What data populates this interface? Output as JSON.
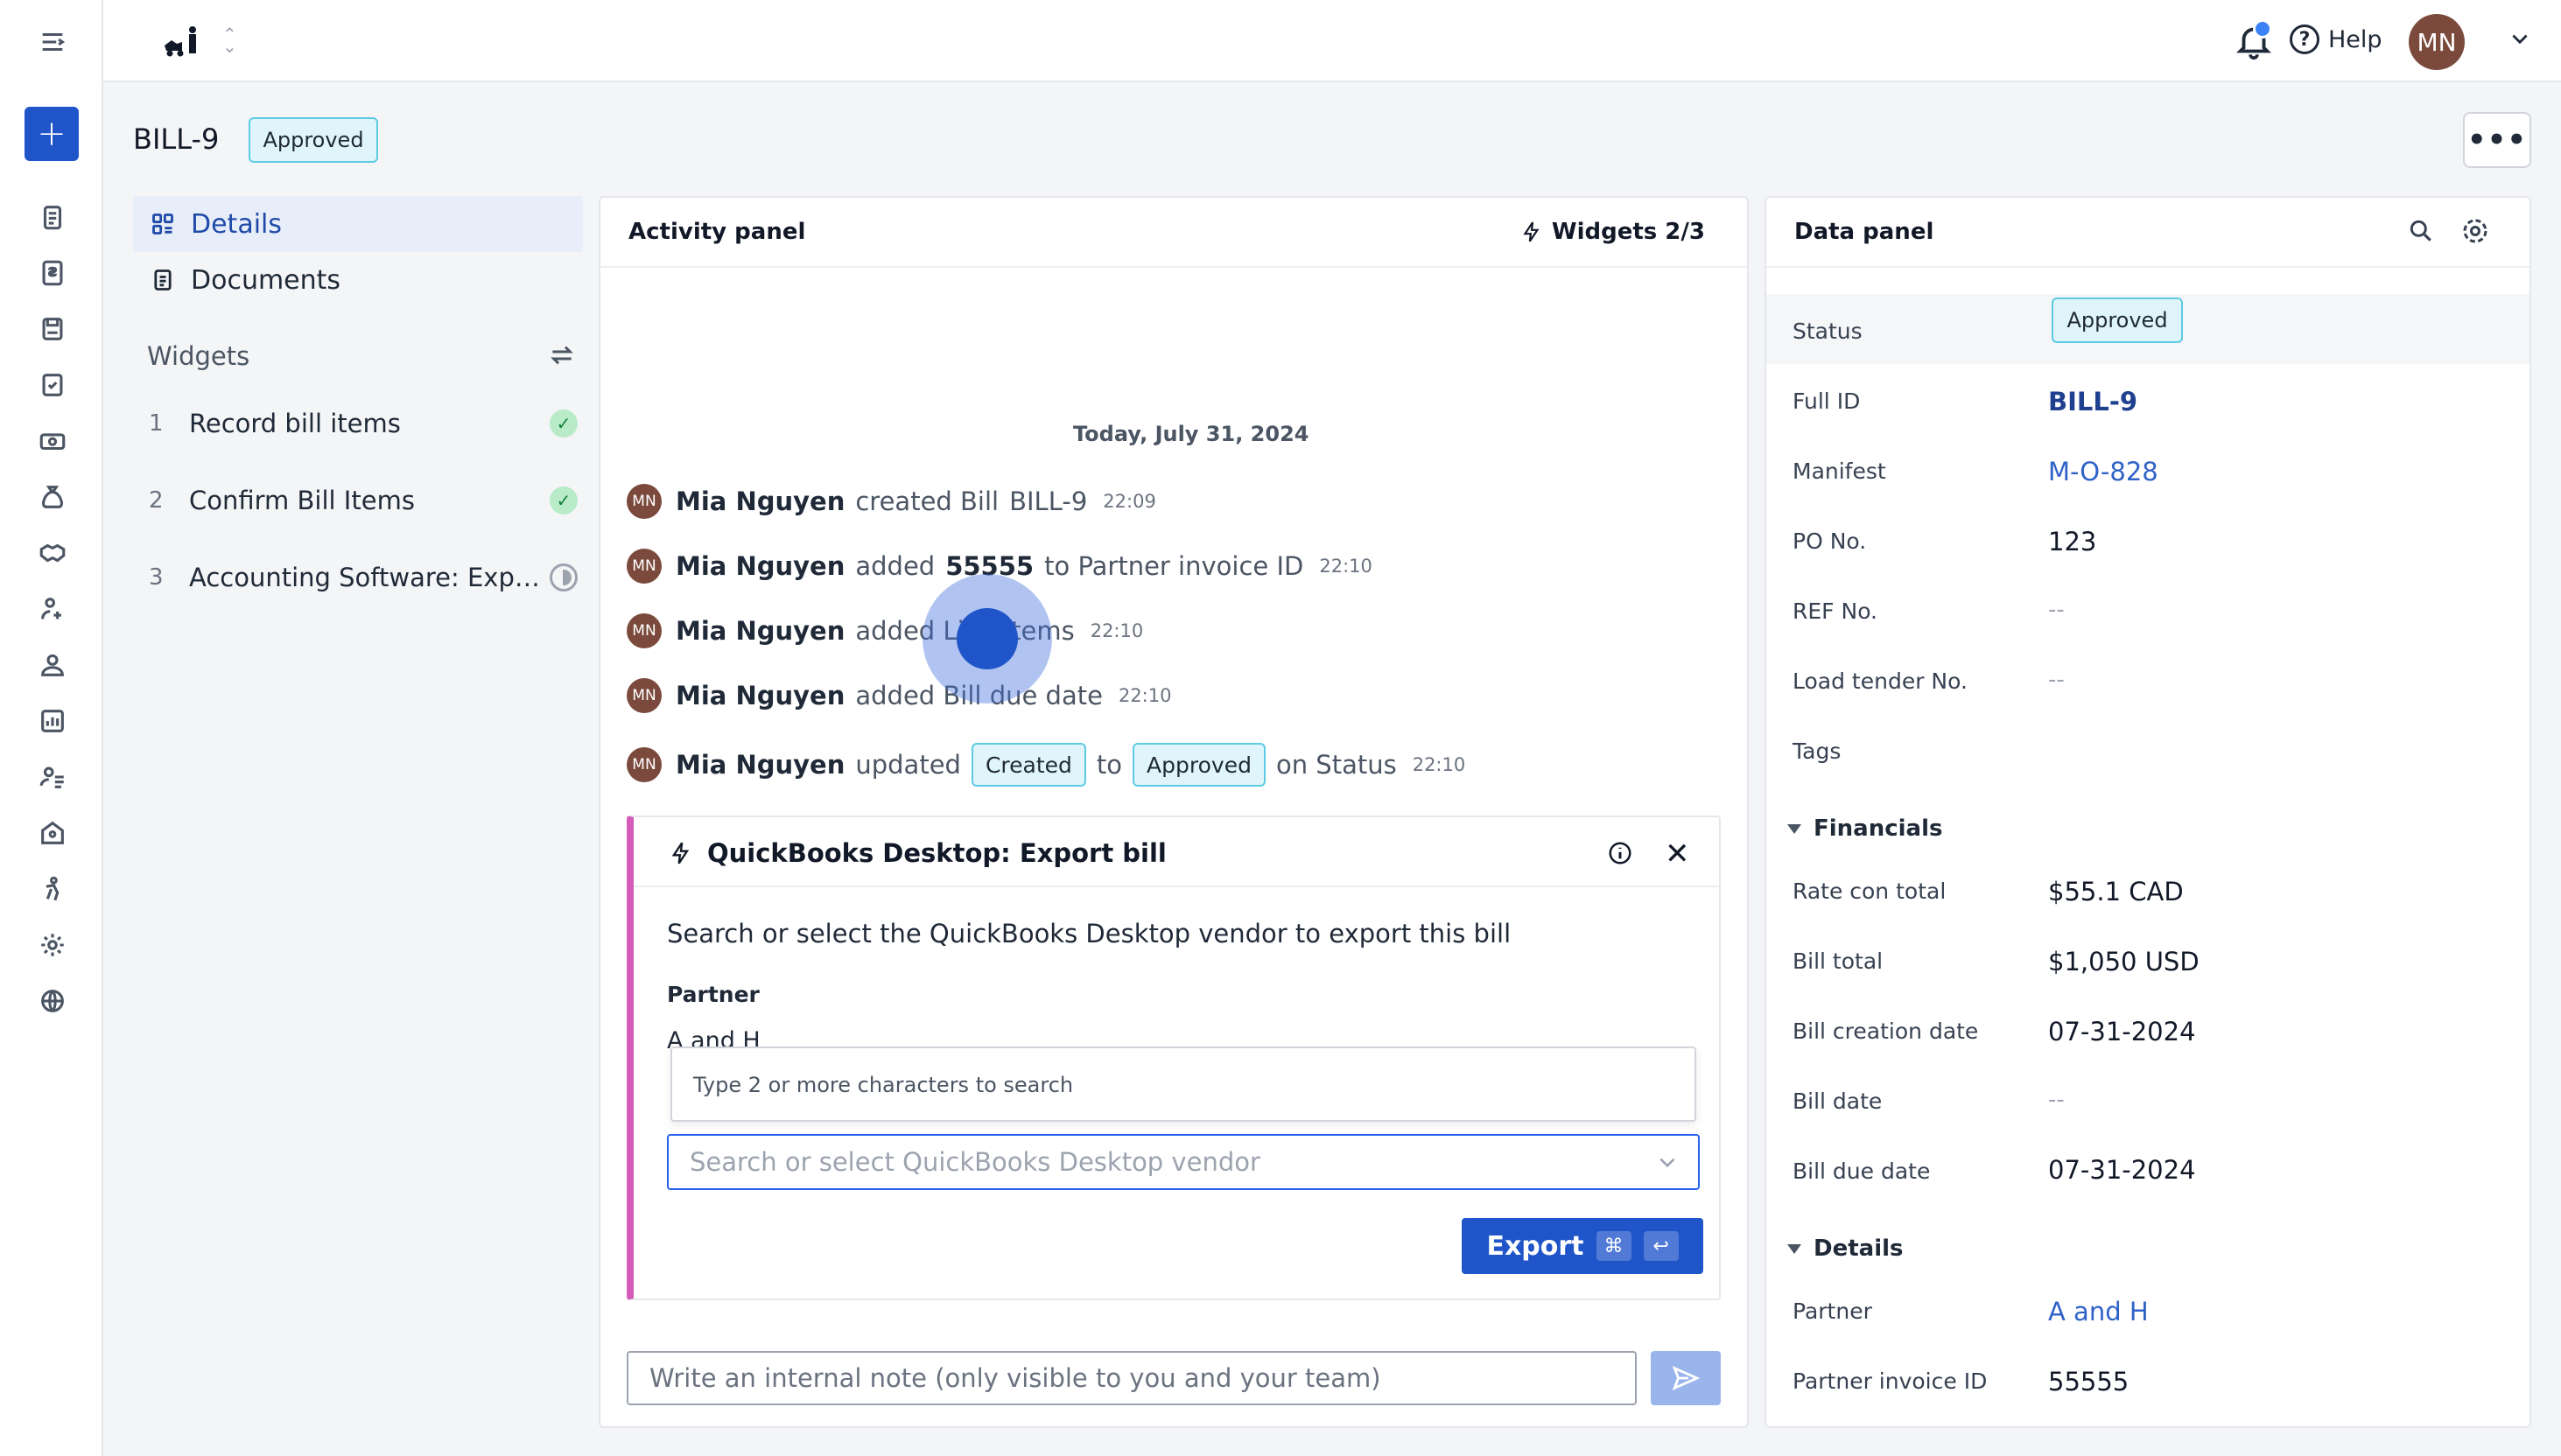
{
  "sidebar_rail": {
    "new_button": "+",
    "icons": [
      "menu-icon",
      "clipboard-icon",
      "invoice-icon",
      "save-icon",
      "checklist-icon",
      "money-icon",
      "moneybag-icon",
      "handshake-icon",
      "person-gear-icon",
      "people-icon",
      "chart-icon",
      "user-settings-icon",
      "building-icon",
      "accessibility-icon",
      "gear-icon",
      "globe-icon"
    ]
  },
  "topbar": {
    "help_label": "Help",
    "help_glyph": "?",
    "avatar_initials": "MN"
  },
  "header": {
    "bill_id": "BILL-9",
    "status": "Approved",
    "more_glyph": "•••"
  },
  "left_nav": {
    "items": [
      {
        "label": "Details",
        "icon": "details-icon",
        "active": true
      },
      {
        "label": "Documents",
        "icon": "document-icon",
        "active": false
      }
    ],
    "widgets_title": "Widgets",
    "widgets": [
      {
        "num": "1",
        "label": "Record bill items",
        "state": "done"
      },
      {
        "num": "2",
        "label": "Confirm Bill Items",
        "state": "done"
      },
      {
        "num": "3",
        "label": "Accounting Software: Export Bill",
        "state": "pending"
      }
    ]
  },
  "activity_panel": {
    "title": "Activity panel",
    "widgets_count": "Widgets 2/3",
    "date_separator": "Today, July 31, 2024",
    "avatar_initials": "MN",
    "events": [
      {
        "user": "Mia Nguyen",
        "pre": "created Bill",
        "strong": "",
        "post": "BILL-9",
        "time": "22:09"
      },
      {
        "user": "Mia Nguyen",
        "pre": "added",
        "strong": "55555",
        "post": "to Partner invoice ID",
        "time": "22:10"
      },
      {
        "user": "Mia Nguyen",
        "pre": "added Line items",
        "strong": "",
        "post": "",
        "time": "22:10"
      },
      {
        "user": "Mia Nguyen",
        "pre": "added Bill due date",
        "strong": "",
        "post": "",
        "time": "22:10"
      },
      {
        "user": "Mia Nguyen",
        "pre": "updated",
        "from": "Created",
        "to_word": "to",
        "to": "Approved",
        "post": "on Status",
        "time": "22:10"
      }
    ],
    "export_widget": {
      "title": "QuickBooks Desktop: Export bill",
      "close_glyph": "✕",
      "description": "Search or select the QuickBooks Desktop vendor to export this bill",
      "partner_label": "Partner",
      "partner_value": "A and H",
      "dropdown_hint": "Type 2 or more characters to search",
      "vendor_placeholder": "Search or select QuickBooks Desktop vendor",
      "vendor_value": "",
      "export_label": "Export",
      "kbd_cmd": "⌘",
      "kbd_enter": "↩"
    },
    "note_placeholder": "Write an internal note (only visible to you and your team)"
  },
  "data_panel": {
    "title": "Data panel",
    "status_label": "Status",
    "status_value": "Approved",
    "fields": [
      {
        "label": "Full ID",
        "value": "BILL-9",
        "style": "link-bold"
      },
      {
        "label": "Manifest",
        "value": "M-O-828",
        "style": "link"
      },
      {
        "label": "PO No.",
        "value": "123",
        "style": ""
      },
      {
        "label": "REF No.",
        "value": "--",
        "style": "muted"
      },
      {
        "label": "Load tender No.",
        "value": "--",
        "style": "muted"
      },
      {
        "label": "Tags",
        "value": "",
        "style": ""
      }
    ],
    "financials_title": "Financials",
    "financials": [
      {
        "label": "Rate con total",
        "value": "$55.1 CAD",
        "style": ""
      },
      {
        "label": "Bill total",
        "value": "$1,050 USD",
        "style": ""
      },
      {
        "label": "Bill creation date",
        "value": "07-31-2024",
        "style": ""
      },
      {
        "label": "Bill date",
        "value": "--",
        "style": "muted"
      },
      {
        "label": "Bill due date",
        "value": "07-31-2024",
        "style": ""
      }
    ],
    "details_title": "Details",
    "details": [
      {
        "label": "Partner",
        "value": "A and H",
        "style": "link"
      },
      {
        "label": "Partner invoice ID",
        "value": "55555",
        "style": ""
      }
    ]
  },
  "colors": {
    "primary": "#1f55c9",
    "badge_bg": "#e0f5fb",
    "badge_border": "#5ccbe3",
    "avatar": "#7b4a3c",
    "widget_accent": "#d45bb8"
  }
}
